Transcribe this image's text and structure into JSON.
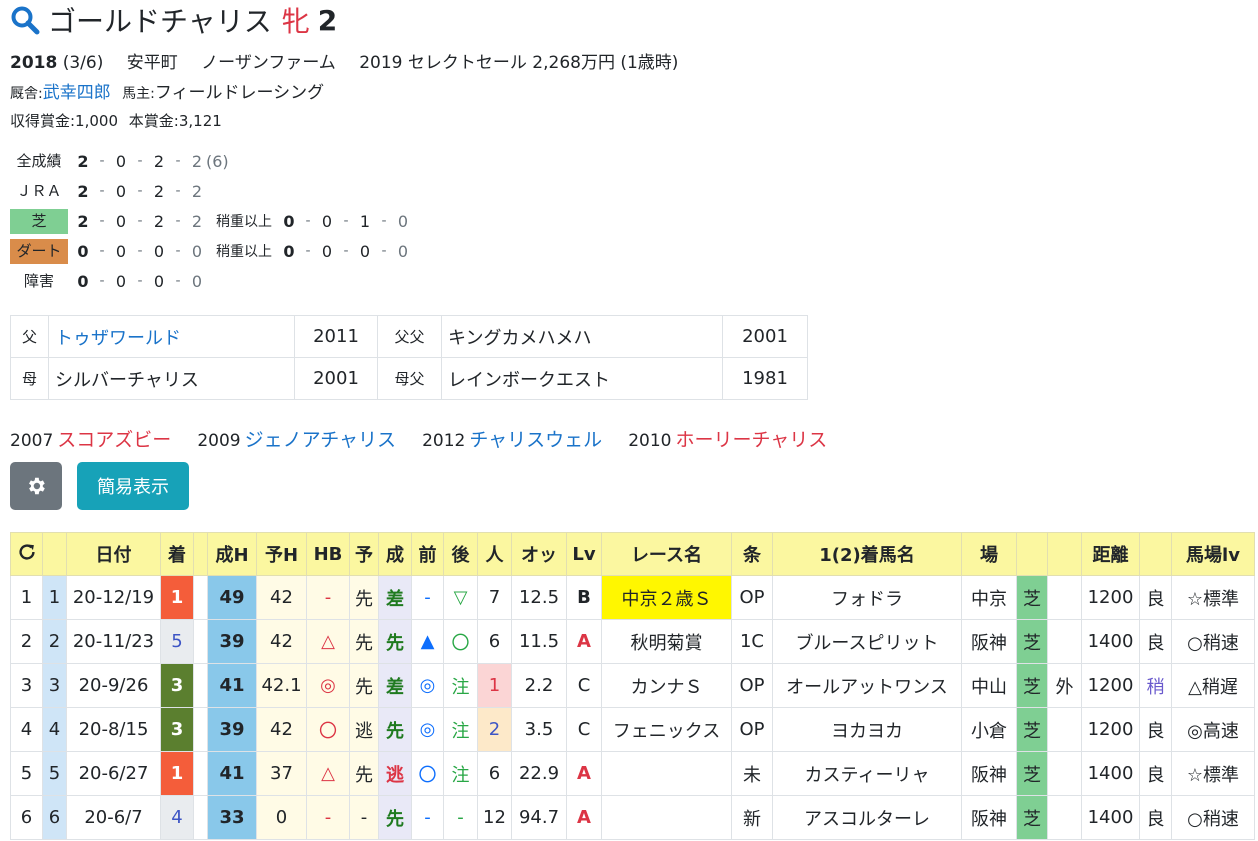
{
  "horse": {
    "name": "ゴールドチャリス",
    "sex": "牝",
    "age": "2",
    "birth_year": "2018",
    "birth_date": "(3/6)",
    "birthplace": "安平町",
    "breeder": "ノーザンファーム",
    "sale": "2019 セレクトセール 2,268万円 (1歳時)",
    "trainer_label": "厩舎:",
    "trainer": "武幸四郎",
    "owner_label": "馬主:",
    "owner": "フィールドレーシング",
    "earnings": "収得賞金:1,000",
    "prize": "本賞金:3,121"
  },
  "records": [
    {
      "label": "全成績",
      "v": [
        "2",
        "0",
        "2",
        "2"
      ],
      "extra": "(6)"
    },
    {
      "label": "ＪＲＡ",
      "v": [
        "2",
        "0",
        "2",
        "2"
      ],
      "extra": ""
    },
    {
      "label": "芝",
      "v": [
        "2",
        "0",
        "2",
        "2"
      ],
      "heavy_label": "稍重以上",
      "hv": [
        "0",
        "0",
        "1",
        "0"
      ]
    },
    {
      "label": "ダート",
      "v": [
        "0",
        "0",
        "0",
        "0"
      ],
      "heavy_label": "稍重以上",
      "hv": [
        "0",
        "0",
        "0",
        "0"
      ]
    },
    {
      "label": "障害",
      "v": [
        "0",
        "0",
        "0",
        "0"
      ]
    }
  ],
  "pedigree": {
    "sire_label": "父",
    "sire": "トゥザワールド",
    "sire_year": "2011",
    "sire_sire_label": "父父",
    "sire_sire": "キングカメハメハ",
    "sire_sire_year": "2001",
    "dam_label": "母",
    "dam": "シルバーチャリス",
    "dam_year": "2001",
    "dam_sire_label": "母父",
    "dam_sire": "レインボークエスト",
    "dam_sire_year": "1981"
  },
  "siblings": [
    {
      "year": "2007",
      "name": "スコアズビー",
      "color": "#dc3545"
    },
    {
      "year": "2009",
      "name": "ジェノアチャリス",
      "color": "#1a73c9"
    },
    {
      "year": "2012",
      "name": "チャリスウェル",
      "color": "#1a73c9"
    },
    {
      "year": "2010",
      "name": "ホーリーチャリス",
      "color": "#dc3545"
    }
  ],
  "buttons": {
    "simple": "簡易表示"
  },
  "table": {
    "headers": [
      "",
      "日付",
      "着",
      "",
      "成H",
      "予H",
      "HB",
      "予",
      "成",
      "前",
      "後",
      "人",
      "オッ",
      "Lv",
      "レース名",
      "条",
      "1(2)着馬名",
      "場",
      "",
      "",
      "距離",
      "",
      "馬場lv"
    ],
    "rows": [
      {
        "n": "1",
        "i": "1",
        "date": "20-12/19",
        "chaku": "1",
        "seiH": "49",
        "yoH": "42",
        "hb": "-",
        "yo": "先",
        "sei": "差",
        "zen": "-",
        "go": "▽",
        "pop": "7",
        "odds": "12.5",
        "lv": "B",
        "race": "中京２歳Ｓ",
        "jo": "OP",
        "horse": "フォドラ",
        "ba": "中京",
        "surf": "芝",
        "side": "",
        "dist": "1200",
        "baba": "良",
        "bl": "☆標準"
      },
      {
        "n": "2",
        "i": "2",
        "date": "20-11/23",
        "chaku": "5",
        "seiH": "39",
        "yoH": "42",
        "hb": "△",
        "yo": "先",
        "sei": "先",
        "zen": "▲",
        "go": "〇",
        "pop": "6",
        "odds": "11.5",
        "lv": "A",
        "race": "秋明菊賞",
        "jo": "1C",
        "horse": "ブルースピリット",
        "ba": "阪神",
        "surf": "芝",
        "side": "",
        "dist": "1400",
        "baba": "良",
        "bl": "○稍速"
      },
      {
        "n": "3",
        "i": "3",
        "date": "20-9/26",
        "chaku": "3",
        "seiH": "41",
        "yoH": "42.1",
        "hb": "◎",
        "yo": "先",
        "sei": "差",
        "zen": "◎",
        "go": "注",
        "pop": "1",
        "odds": "2.2",
        "lv": "C",
        "race": "カンナＳ",
        "jo": "OP",
        "horse": "オールアットワンス",
        "ba": "中山",
        "surf": "芝",
        "side": "外",
        "dist": "1200",
        "baba": "稍",
        "bl": "△稍遅"
      },
      {
        "n": "4",
        "i": "4",
        "date": "20-8/15",
        "chaku": "3",
        "seiH": "39",
        "yoH": "42",
        "hb": "〇",
        "yo": "逃",
        "sei": "先",
        "zen": "◎",
        "go": "注",
        "pop": "2",
        "odds": "3.5",
        "lv": "C",
        "race": "フェニックス",
        "jo": "OP",
        "horse": "ヨカヨカ",
        "ba": "小倉",
        "surf": "芝",
        "side": "",
        "dist": "1200",
        "baba": "良",
        "bl": "◎高速"
      },
      {
        "n": "5",
        "i": "5",
        "date": "20-6/27",
        "chaku": "1",
        "seiH": "41",
        "yoH": "37",
        "hb": "△",
        "yo": "先",
        "sei": "逃",
        "zen": "〇",
        "go": "注",
        "pop": "6",
        "odds": "22.9",
        "lv": "A",
        "race": "",
        "jo": "未",
        "horse": "カスティーリャ",
        "ba": "阪神",
        "surf": "芝",
        "side": "",
        "dist": "1400",
        "baba": "良",
        "bl": "☆標準"
      },
      {
        "n": "6",
        "i": "6",
        "date": "20-6/7",
        "chaku": "4",
        "seiH": "33",
        "yoH": "0",
        "hb": "-",
        "yo": "-",
        "sei": "先",
        "zen": "-",
        "go": "-",
        "pop": "12",
        "odds": "94.7",
        "lv": "A",
        "race": "",
        "jo": "新",
        "horse": "アスコルターレ",
        "ba": "阪神",
        "surf": "芝",
        "side": "",
        "dist": "1400",
        "baba": "良",
        "bl": "○稍速"
      }
    ]
  }
}
